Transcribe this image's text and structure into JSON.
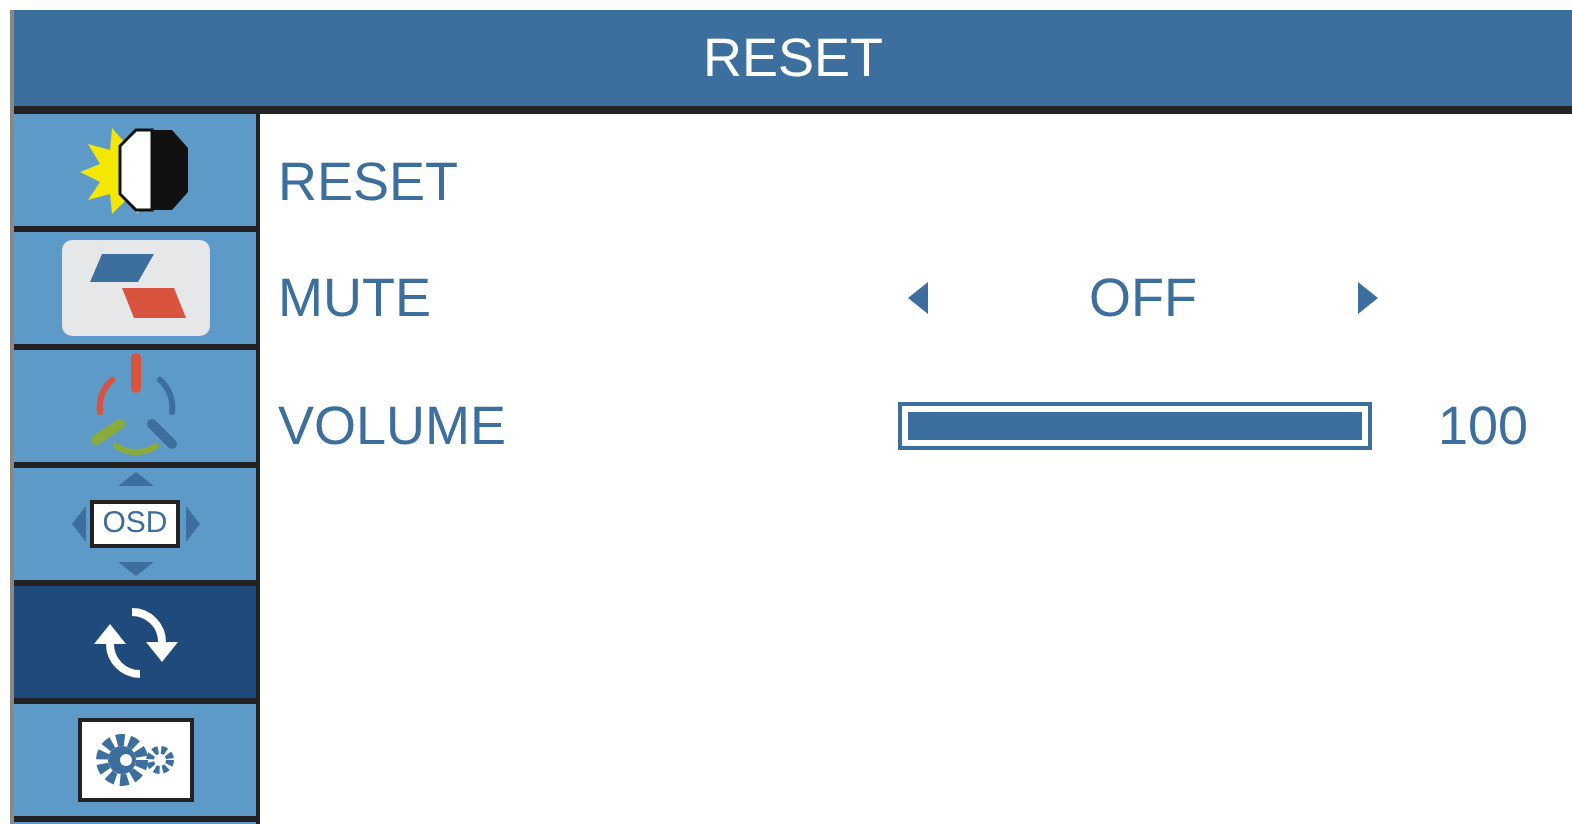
{
  "title": "RESET",
  "sidebar": [
    {
      "kind": "brightness",
      "selected": false
    },
    {
      "kind": "image",
      "selected": false
    },
    {
      "kind": "color",
      "selected": false
    },
    {
      "kind": "osd",
      "label": "OSD",
      "selected": false
    },
    {
      "kind": "reset",
      "selected": true
    },
    {
      "kind": "settings",
      "selected": false
    }
  ],
  "rows": [
    {
      "kind": "action",
      "label": "RESET"
    },
    {
      "kind": "toggle",
      "label": "MUTE",
      "value": "OFF"
    },
    {
      "kind": "slider",
      "label": "VOLUME",
      "level": 1,
      "reading": "100"
    }
  ]
}
